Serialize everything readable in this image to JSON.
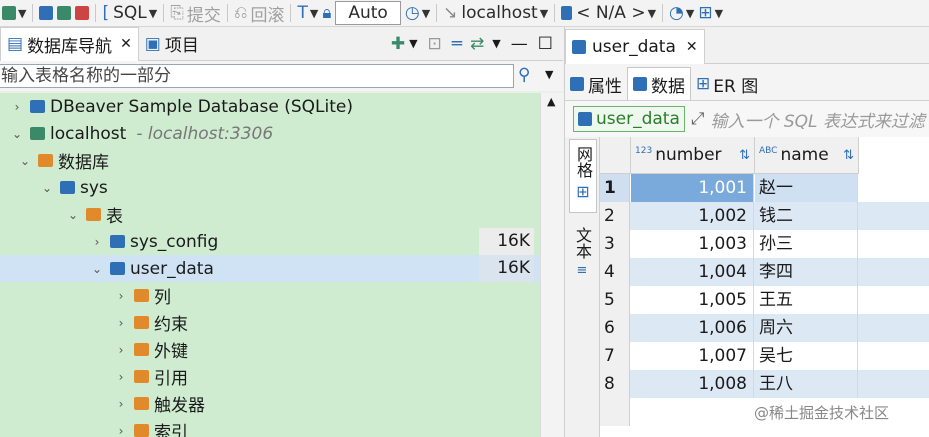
{
  "toolbar": {
    "sql_label": "SQL",
    "commit_label": "提交",
    "rollback_label": "回滚",
    "auto_label": "Auto",
    "connection_label": "localhost",
    "schema_label": "< N/A >"
  },
  "left": {
    "tab_navigator": "数据库导航",
    "tab_projects": "项目",
    "filter_placeholder": "输入表格名称的一部分",
    "tree": [
      {
        "label": "DBeaver Sample Database (SQLite)",
        "twisty": "›",
        "icon": "database-icon",
        "color": "#2f6fb5"
      },
      {
        "label": "localhost",
        "sub": "- localhost:3306",
        "twisty": "⌄",
        "icon": "connection-icon",
        "color": "#3a8a6a"
      },
      {
        "label": "数据库",
        "twisty": "⌄",
        "icon": "folder-icon",
        "color": "#e08a2b"
      },
      {
        "label": "sys",
        "twisty": "⌄",
        "icon": "schema-icon",
        "color": "#2f6fb5"
      },
      {
        "label": "表",
        "twisty": "⌄",
        "icon": "tables-folder-icon",
        "color": "#e08a2b"
      },
      {
        "label": "sys_config",
        "twisty": "›",
        "icon": "table-icon",
        "color": "#2f6fb5",
        "size": "16K"
      },
      {
        "label": "user_data",
        "twisty": "⌄",
        "icon": "table-icon",
        "color": "#2f6fb5",
        "size": "16K",
        "selected": true
      },
      {
        "label": "列",
        "twisty": "›",
        "icon": "columns-folder-icon",
        "color": "#e08a2b"
      },
      {
        "label": "约束",
        "twisty": "›",
        "icon": "constraints-folder-icon",
        "color": "#e08a2b"
      },
      {
        "label": "外键",
        "twisty": "›",
        "icon": "folder-icon",
        "color": "#e08a2b"
      },
      {
        "label": "引用",
        "twisty": "›",
        "icon": "folder-icon",
        "color": "#e08a2b"
      },
      {
        "label": "触发器",
        "twisty": "›",
        "icon": "folder-icon",
        "color": "#e08a2b"
      },
      {
        "label": "索引",
        "twisty": "›",
        "icon": "folder-icon",
        "color": "#e08a2b"
      }
    ]
  },
  "right": {
    "editor_tab": "user_data",
    "tab_properties": "属性",
    "tab_data": "数据",
    "tab_er": "ER 图",
    "table_name": "user_data",
    "sql_filter_placeholder": "输入一个 SQL 表达式来过滤",
    "vtab_grid": "网格",
    "vtab_text": "文本",
    "columns": [
      {
        "type_badge": "123",
        "name": "number"
      },
      {
        "type_badge": "ABC",
        "name": "name"
      }
    ],
    "rows": [
      {
        "n": "1",
        "number": "1,001",
        "name": "赵一"
      },
      {
        "n": "2",
        "number": "1,002",
        "name": "钱二"
      },
      {
        "n": "3",
        "number": "1,003",
        "name": "孙三"
      },
      {
        "n": "4",
        "number": "1,004",
        "name": "李四"
      },
      {
        "n": "5",
        "number": "1,005",
        "name": "王五"
      },
      {
        "n": "6",
        "number": "1,006",
        "name": "周六"
      },
      {
        "n": "7",
        "number": "1,007",
        "name": "吴七"
      },
      {
        "n": "8",
        "number": "1,008",
        "name": "王八"
      }
    ]
  },
  "watermark": "@稀土掘金技术社区"
}
